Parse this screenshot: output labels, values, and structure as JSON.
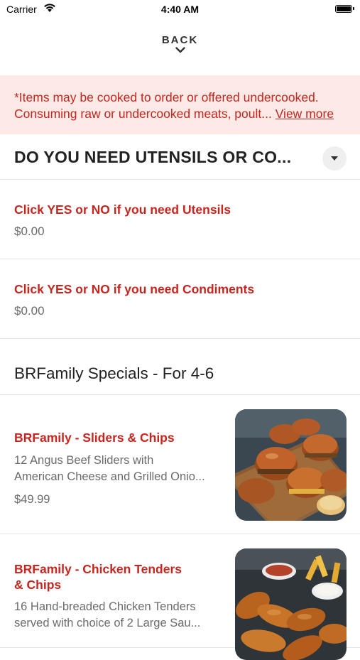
{
  "status_bar": {
    "carrier": "Carrier",
    "time": "4:40 AM"
  },
  "header": {
    "back_label": "BACK"
  },
  "notice": {
    "line1": "*Items may be cooked to order or offered undercooked.",
    "line2": "Consuming raw or undercooked meats, poult...",
    "link": "View more"
  },
  "section": {
    "title": "DO YOU NEED UTENSILS OR CO...",
    "options": [
      {
        "title": "Click YES or NO if you need Utensils",
        "price": "$0.00"
      },
      {
        "title": "Click YES or NO if you need Condiments",
        "price": "$0.00"
      }
    ]
  },
  "category": {
    "title": "BRFamily Specials - For 4-6"
  },
  "items": [
    {
      "name": "BRFamily - Sliders & Chips",
      "desc_line1": "12 Angus Beef Sliders with",
      "desc_line2": "American Cheese and Grilled Onio...",
      "price": "$49.99"
    },
    {
      "name_line1": "BRFamily - Chicken Tenders",
      "name_line2": "& Chips",
      "desc_line1": "16 Hand-breaded Chicken Tenders",
      "desc_line2": "served with choice of 2 Large Sau..."
    }
  ],
  "colors": {
    "accent_red": "#c8251f",
    "notice_bg": "#fde9e5",
    "muted_text": "#6b6b6b"
  },
  "icons": [
    "wifi-icon",
    "battery-icon",
    "chevron-down-icon",
    "dropdown-caret-icon"
  ]
}
